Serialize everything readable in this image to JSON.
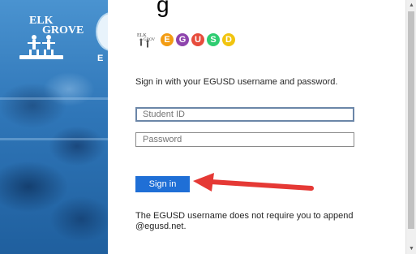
{
  "page_title_fragment": "g",
  "left_panel": {
    "logo_line1": "ELK",
    "logo_line2": "GROVE",
    "side_letter": "E"
  },
  "brand": {
    "letters": [
      "E",
      "G",
      "U",
      "S",
      "D"
    ],
    "colors": [
      "#f39c12",
      "#8e44ad",
      "#e74c3c",
      "#2ecc71",
      "#f1c40f"
    ]
  },
  "form": {
    "instruction": "Sign in with your EGUSD username and password.",
    "username_placeholder": "Student ID",
    "password_placeholder": "Password",
    "signin_label": "Sign in",
    "note": "The EGUSD username does not require you to append @egusd.net."
  },
  "colors": {
    "accent": "#1f6fd6",
    "arrow": "#e53935"
  },
  "icons": {
    "scroll_up": "▲",
    "scroll_down": "▼"
  }
}
